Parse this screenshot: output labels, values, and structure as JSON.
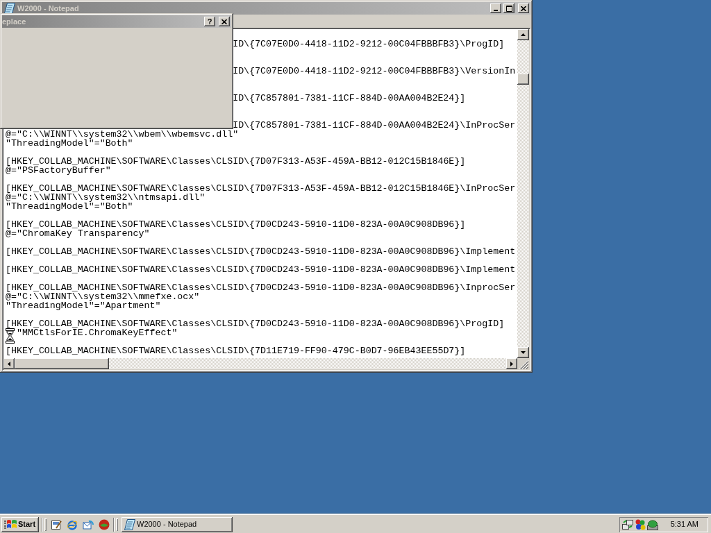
{
  "notepad": {
    "title": "W2000 - Notepad",
    "active": false,
    "document": [
      {
        "kind": "hidden-value",
        "lines": [
          {
            "kind": "under-dialog",
            "text": "ID\\{7C07E0D0-4418-11D2-9212-00C04FBBBFB3}\\ProgID]"
          }
        ]
      },
      {
        "kind": "hidden-value",
        "lines": [
          {
            "kind": "under-dialog",
            "text": "ID\\{7C07E0D0-4418-11D2-9212-00C04FBBBFB3}\\VersionIn"
          }
        ]
      },
      {
        "kind": "hidden-value",
        "lines": [
          {
            "kind": "under-dialog",
            "text": "ID\\{7C857801-7381-11CF-884D-00AA004B2E24}]"
          }
        ]
      },
      {
        "kind": "plain",
        "lines": [
          {
            "kind": "under-dialog",
            "text": "ID\\{7C857801-7381-11CF-884D-00AA004B2E24}\\InProcSer"
          },
          {
            "kind": "full",
            "text": "@=\"C:\\\\WINNT\\\\system32\\\\wbem\\\\wbemsvc.dll\""
          },
          {
            "kind": "full",
            "text": "\"ThreadingModel\"=\"Both\""
          }
        ]
      },
      {
        "kind": "plain",
        "lines": [
          {
            "kind": "full",
            "text": "[HKEY_COLLAB_MACHINE\\SOFTWARE\\Classes\\CLSID\\{7D07F313-A53F-459A-BB12-012C15B1846E}]"
          },
          {
            "kind": "full",
            "text": "@=\"PSFactoryBuffer\""
          }
        ]
      },
      {
        "kind": "plain",
        "lines": [
          {
            "kind": "full",
            "text": "[HKEY_COLLAB_MACHINE\\SOFTWARE\\Classes\\CLSID\\{7D07F313-A53F-459A-BB12-012C15B1846E}\\InProcSer"
          },
          {
            "kind": "full",
            "text": "@=\"C:\\\\WINNT\\\\system32\\\\ntmsapi.dll\""
          },
          {
            "kind": "full",
            "text": "\"ThreadingModel\"=\"Both\""
          }
        ]
      },
      {
        "kind": "plain",
        "lines": [
          {
            "kind": "full",
            "text": "[HKEY_COLLAB_MACHINE\\SOFTWARE\\Classes\\CLSID\\{7D0CD243-5910-11D0-823A-00A0C908DB96}]"
          },
          {
            "kind": "full",
            "text": "@=\"ChromaKey Transparency\""
          }
        ]
      },
      {
        "kind": "plain",
        "lines": [
          {
            "kind": "full",
            "text": "[HKEY_COLLAB_MACHINE\\SOFTWARE\\Classes\\CLSID\\{7D0CD243-5910-11D0-823A-00A0C908DB96}\\Implement"
          }
        ]
      },
      {
        "kind": "plain",
        "lines": [
          {
            "kind": "full",
            "text": "[HKEY_COLLAB_MACHINE\\SOFTWARE\\Classes\\CLSID\\{7D0CD243-5910-11D0-823A-00A0C908DB96}\\Implement"
          }
        ]
      },
      {
        "kind": "plain",
        "lines": [
          {
            "kind": "full",
            "text": "[HKEY_COLLAB_MACHINE\\SOFTWARE\\Classes\\CLSID\\{7D0CD243-5910-11D0-823A-00A0C908DB96}\\InprocSer"
          },
          {
            "kind": "full",
            "text": "@=\"C:\\\\WINNT\\\\system32\\\\mmefxe.ocx\""
          },
          {
            "kind": "full",
            "text": "\"ThreadingModel\"=\"Apartment\""
          }
        ]
      },
      {
        "kind": "plain",
        "lines": [
          {
            "kind": "full",
            "text": "[HKEY_COLLAB_MACHINE\\SOFTWARE\\Classes\\CLSID\\{7D0CD243-5910-11D0-823A-00A0C908DB96}\\ProgID]"
          },
          {
            "kind": "under-pointer",
            "text": "\"MMCtlsForIE.ChromaKeyEffect\""
          }
        ]
      },
      {
        "kind": "plain",
        "lines": [
          {
            "kind": "full",
            "text": "[HKEY_COLLAB_MACHINE\\SOFTWARE\\Classes\\CLSID\\{7D11E719-FF90-479C-B0D7-96EB43EE55D7}]"
          }
        ]
      }
    ]
  },
  "replace_dialog": {
    "title": "eplace",
    "active": false,
    "help_label": "?"
  },
  "taskbar": {
    "start_label": "Start",
    "tasks": [
      {
        "label": "W2000 - Notepad",
        "selected": false
      }
    ],
    "clock": "5:31 AM"
  }
}
